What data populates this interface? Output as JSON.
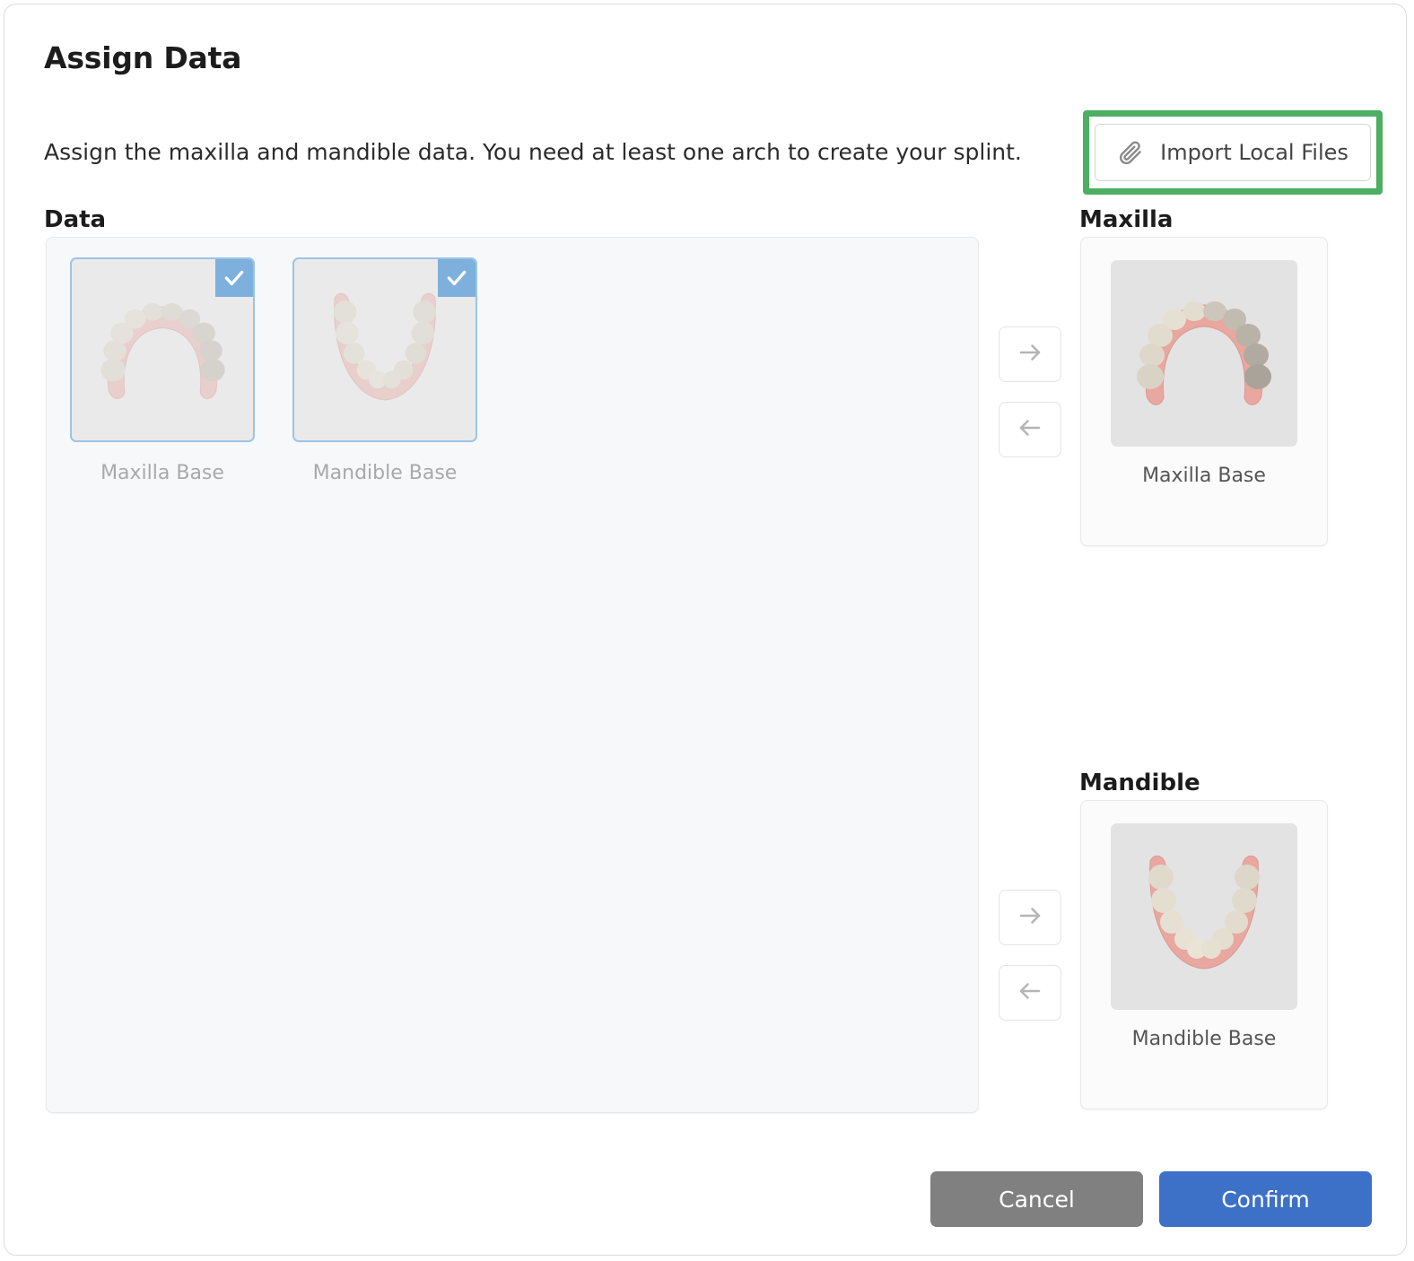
{
  "dialog": {
    "title": "Assign Data",
    "description": "Assign the maxilla and mandible data. You need at least one arch to create your splint."
  },
  "toolbar": {
    "import_label": "Import Local Files",
    "import_icon": "paperclip-icon",
    "highlight_color": "#4caf62"
  },
  "sections": {
    "data_heading": "Data",
    "maxilla_heading": "Maxilla",
    "mandible_heading": "Mandible"
  },
  "data_items": [
    {
      "label": "Maxilla Base",
      "selected": true,
      "check_icon": "check-icon",
      "arch": "upper"
    },
    {
      "label": "Mandible Base",
      "selected": true,
      "check_icon": "check-icon",
      "arch": "lower"
    }
  ],
  "maxilla_panel": {
    "assigned_label": "Maxilla Base",
    "arrow_right_icon": "arrow-right-icon",
    "arrow_left_icon": "arrow-left-icon"
  },
  "mandible_panel": {
    "assigned_label": "Mandible Base",
    "arrow_right_icon": "arrow-right-icon",
    "arrow_left_icon": "arrow-left-icon"
  },
  "footer": {
    "cancel_label": "Cancel",
    "confirm_label": "Confirm",
    "cancel_color": "#808080",
    "confirm_color": "#3d70c7"
  }
}
